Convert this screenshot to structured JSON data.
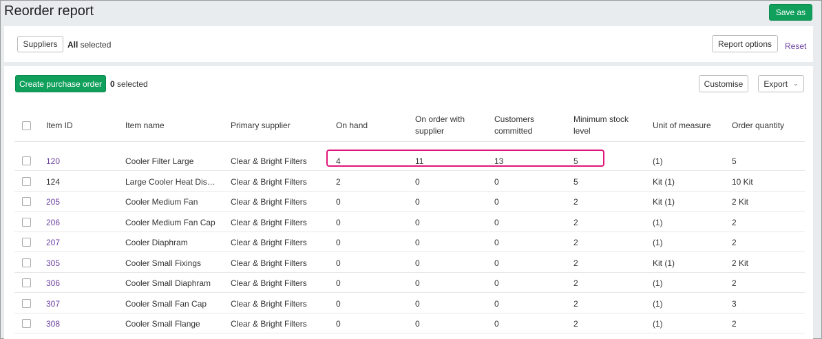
{
  "page": {
    "title": "Reorder report",
    "save_as_label": "Save as"
  },
  "filters": {
    "suppliers_label": "Suppliers",
    "suppliers_selected_bold": "All",
    "suppliers_selected_text": " selected",
    "report_options_label": "Report options",
    "reset_label": "Reset"
  },
  "toolbar": {
    "create_po_label": "Create purchase order",
    "selected_count": "0",
    "selected_text": " selected",
    "customise_label": "Customise",
    "export_label": "Export"
  },
  "table": {
    "headers": {
      "item_id": "Item ID",
      "item_name": "Item name",
      "primary_supplier": "Primary supplier",
      "on_hand": "On hand",
      "on_order_1": "On order with",
      "on_order_2": "supplier",
      "committed_1": "Customers",
      "committed_2": "committed",
      "min_stock_1": "Minimum stock",
      "min_stock_2": "level",
      "unit": "Unit of measure",
      "order_qty": "Order quantity"
    },
    "rows": [
      {
        "id": "120",
        "link": true,
        "name": "Cooler Filter Large",
        "supplier": "Clear & Bright Filters",
        "on_hand": "4",
        "on_order": "11",
        "committed": "13",
        "min_stock": "5",
        "unit": "(1)",
        "order_qty": "5"
      },
      {
        "id": "124",
        "link": false,
        "name": "Large Cooler Heat Dissip...",
        "supplier": "Clear & Bright Filters",
        "on_hand": "2",
        "on_order": "0",
        "committed": "0",
        "min_stock": "5",
        "unit": "Kit (1)",
        "order_qty": "10 Kit"
      },
      {
        "id": "205",
        "link": true,
        "name": "Cooler Medium Fan",
        "supplier": "Clear & Bright Filters",
        "on_hand": "0",
        "on_order": "0",
        "committed": "0",
        "min_stock": "2",
        "unit": "Kit (1)",
        "order_qty": "2 Kit"
      },
      {
        "id": "206",
        "link": true,
        "name": "Cooler Medium Fan Cap",
        "supplier": "Clear & Bright Filters",
        "on_hand": "0",
        "on_order": "0",
        "committed": "0",
        "min_stock": "2",
        "unit": "(1)",
        "order_qty": "2"
      },
      {
        "id": "207",
        "link": true,
        "name": "Cooler Diaphram",
        "supplier": "Clear & Bright Filters",
        "on_hand": "0",
        "on_order": "0",
        "committed": "0",
        "min_stock": "2",
        "unit": "(1)",
        "order_qty": "2"
      },
      {
        "id": "305",
        "link": true,
        "name": "Cooler Small Fixings",
        "supplier": "Clear & Bright Filters",
        "on_hand": "0",
        "on_order": "0",
        "committed": "0",
        "min_stock": "2",
        "unit": "Kit (1)",
        "order_qty": "2 Kit"
      },
      {
        "id": "306",
        "link": true,
        "name": "Cooler Small Diaphram",
        "supplier": "Clear & Bright Filters",
        "on_hand": "0",
        "on_order": "0",
        "committed": "0",
        "min_stock": "2",
        "unit": "(1)",
        "order_qty": "2"
      },
      {
        "id": "307",
        "link": true,
        "name": "Cooler Small Fan Cap",
        "supplier": "Clear & Bright Filters",
        "on_hand": "0",
        "on_order": "0",
        "committed": "0",
        "min_stock": "2",
        "unit": "(1)",
        "order_qty": "3"
      },
      {
        "id": "308",
        "link": true,
        "name": "Cooler Small Flange",
        "supplier": "Clear & Bright Filters",
        "on_hand": "0",
        "on_order": "0",
        "committed": "0",
        "min_stock": "2",
        "unit": "(1)",
        "order_qty": "2"
      }
    ]
  },
  "colors": {
    "accent_green": "#10a05c",
    "link_purple": "#6b3fa0",
    "highlight_pink": "#e0177a"
  }
}
